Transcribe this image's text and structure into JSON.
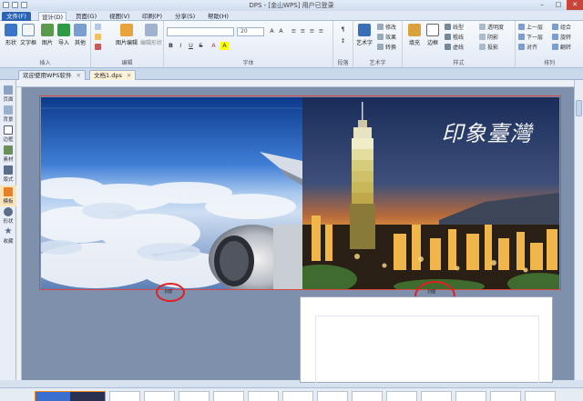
{
  "window": {
    "title": "DPS - [金山WPS] 用户已登录",
    "controls": [
      "minimize",
      "maximize",
      "close"
    ]
  },
  "menu": {
    "file": "文件(F)",
    "tabs": [
      "设计(D)",
      "页面(G)",
      "视图(V)",
      "印刷(P)",
      "分享(S)",
      "帮助(H)"
    ],
    "active_tab": "设计(D)"
  },
  "ribbon": {
    "groups": [
      {
        "label": "插入",
        "buttons": [
          "形状",
          "文字框",
          "图片",
          "导入",
          "其他"
        ]
      },
      {
        "label": "编辑",
        "buttons": [
          "图片编辑",
          "编辑形状"
        ]
      },
      {
        "label": "字体",
        "font_size": "20",
        "format_buttons": [
          "B",
          "I",
          "U",
          "S",
          "A",
          "A"
        ]
      },
      {
        "label": "段落"
      },
      {
        "label": "艺术字",
        "buttons": [
          "艺术字",
          "修改",
          "效果",
          "转换"
        ]
      },
      {
        "label": "样式",
        "buttons": [
          "填充",
          "边框",
          "线型",
          "粗线",
          "虚线",
          "透明度",
          "阴影",
          "投影"
        ]
      },
      {
        "label": "排列",
        "buttons": [
          "上一层",
          "下一层",
          "对齐",
          "组合",
          "旋转",
          "翻转"
        ]
      }
    ]
  },
  "doc_tabs": [
    {
      "label": "欢迎使用WPS软件",
      "active": false
    },
    {
      "label": "文档1.dps",
      "active": true
    }
  ],
  "sidebar": [
    {
      "label": "页面",
      "icon": "page-icon"
    },
    {
      "label": "背景",
      "icon": "background-icon"
    },
    {
      "label": "边框",
      "icon": "border-icon"
    },
    {
      "label": "素材",
      "icon": "material-icon"
    },
    {
      "label": "版式",
      "icon": "layout-icon"
    },
    {
      "label": "模板",
      "icon": "template-icon",
      "active": true
    },
    {
      "label": "形状",
      "icon": "shape-icon"
    },
    {
      "label": "收藏",
      "icon": "star-icon"
    }
  ],
  "canvas": {
    "right_page_title": "印象臺灣",
    "left_page_label": "封底",
    "right_page_label": "封面"
  },
  "colors": {
    "accent": "#2a64b3",
    "canvas_bg": "#7f90ad",
    "highlight": "#e02020"
  }
}
